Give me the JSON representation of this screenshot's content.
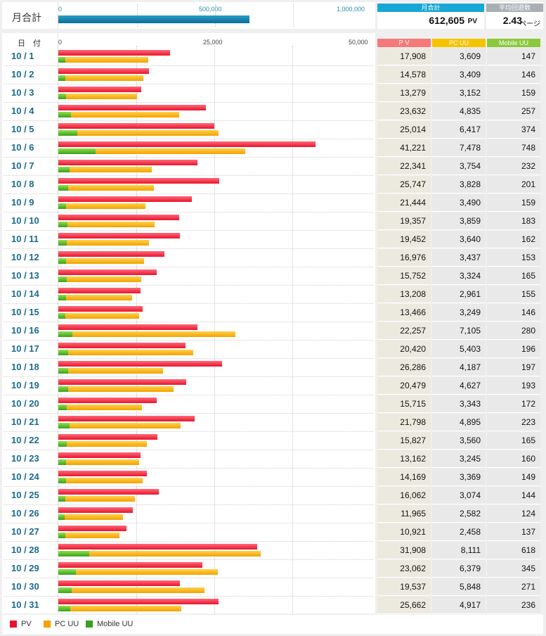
{
  "header": {
    "monthly_total_label": "月合計",
    "total_axis_ticks": [
      "0",
      "500,000",
      "1,000,000"
    ],
    "total_bar_value": 612605,
    "total_bar_max": 1000000,
    "pv_total_title": "月合計",
    "pv_total_value": "612,605",
    "pv_total_unit": "PV",
    "avg_title": "平均回遊数",
    "avg_value": "2.43",
    "avg_unit": "ページ"
  },
  "table": {
    "date_header": "日　付",
    "axis_ticks": [
      "0",
      "25,000",
      "50,000"
    ],
    "col_pv": "ＰＶ",
    "col_pcuu": "PC UU",
    "col_mobile": "Mobile UU"
  },
  "legend": {
    "pv": "PV",
    "pcuu": "PC UU",
    "mobile": "Mobile UU"
  },
  "colors": {
    "pv": "#e8142e",
    "pcuu": "#f3a200",
    "mobile": "#3aa01e",
    "pv_header": "#f47a7a",
    "pcuu_header": "#f5c400",
    "mobile_header": "#8cc83c",
    "total_header": "#18a7d4",
    "avg_header": "#a8b0b4",
    "pv_cell_bg": "#eceadf",
    "other_cell_bg": "#e9e9e9"
  },
  "chart_data": {
    "type": "bar",
    "orientation": "horizontal",
    "xlim": [
      0,
      50000
    ],
    "categories": [
      "10 / 1",
      "10 / 2",
      "10 / 3",
      "10 / 4",
      "10 / 5",
      "10 / 6",
      "10 / 7",
      "10 / 8",
      "10 / 9",
      "10 / 10",
      "10 / 11",
      "10 / 12",
      "10 / 13",
      "10 / 14",
      "10 / 15",
      "10 / 16",
      "10 / 17",
      "10 / 18",
      "10 / 19",
      "10 / 20",
      "10 / 21",
      "10 / 22",
      "10 / 23",
      "10 / 24",
      "10 / 25",
      "10 / 26",
      "10 / 27",
      "10 / 28",
      "10 / 29",
      "10 / 30",
      "10 / 31"
    ],
    "series": [
      {
        "name": "PV",
        "values": [
          17908,
          14578,
          13279,
          23632,
          25014,
          41221,
          22341,
          25747,
          21444,
          19357,
          19452,
          16976,
          15752,
          13208,
          13466,
          22257,
          20420,
          26286,
          20479,
          15715,
          21798,
          15827,
          13162,
          14169,
          16062,
          11965,
          10921,
          31908,
          23062,
          19537,
          25662
        ]
      },
      {
        "name": "PC UU",
        "values": [
          3609,
          3409,
          3152,
          4835,
          6417,
          7478,
          3754,
          3828,
          3490,
          3859,
          3640,
          3437,
          3324,
          2961,
          3249,
          7105,
          5403,
          4187,
          4627,
          3343,
          4895,
          3560,
          3245,
          3369,
          3074,
          2582,
          2458,
          8111,
          6379,
          5848,
          4917
        ]
      },
      {
        "name": "Mobile UU",
        "values": [
          147,
          146,
          159,
          257,
          374,
          748,
          232,
          201,
          159,
          183,
          162,
          153,
          165,
          155,
          146,
          280,
          196,
          197,
          193,
          172,
          223,
          165,
          160,
          149,
          144,
          124,
          137,
          618,
          345,
          271,
          236
        ]
      }
    ]
  }
}
